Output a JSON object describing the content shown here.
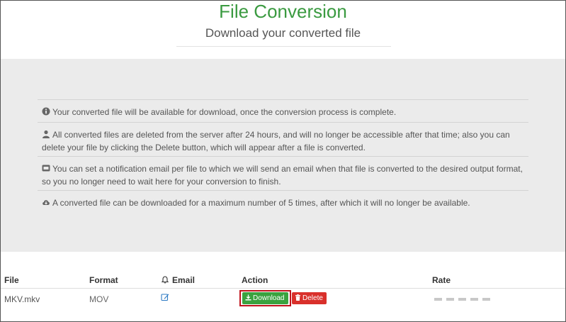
{
  "header": {
    "title": "File Conversion",
    "subtitle": "Download your converted file"
  },
  "info": {
    "items": [
      {
        "icon": "info-circle-icon",
        "text": "Your converted file will be available for download, once the conversion process is complete."
      },
      {
        "icon": "user-icon",
        "text": "All converted files are deleted from the server after 24 hours, and will no longer be accessible after that time; also you can delete your file by clicking the Delete button, which will appear after a file is converted."
      },
      {
        "icon": "envelope-icon",
        "text": "You can set a notification email per file to which we will send an email when that file is converted to the desired output format, so you no longer need to wait here for your conversion to finish."
      },
      {
        "icon": "cloud-download-icon",
        "text": "A converted file can be downloaded for a maximum number of 5 times, after which it will no longer be available."
      }
    ]
  },
  "table": {
    "headers": {
      "file": "File",
      "format": "Format",
      "email": "Email",
      "action": "Action",
      "rate": "Rate"
    },
    "rows": [
      {
        "file": "MKV.mkv",
        "format": "MOV",
        "download_label": "Download",
        "delete_label": "Delete",
        "rating": 0
      }
    ]
  },
  "colors": {
    "title": "#3a9a40",
    "download_button": "#3aa23f",
    "delete_button": "#d9302b",
    "highlight": "#c0121c",
    "info_background": "#ebebeb"
  }
}
